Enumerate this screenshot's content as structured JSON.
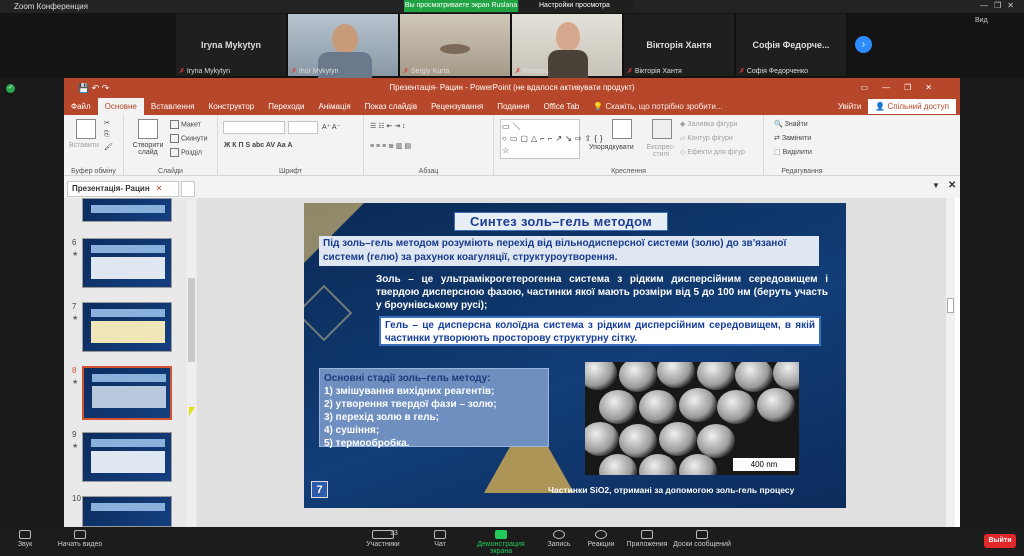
{
  "zoom": {
    "window_title": "Zoom Конференция",
    "share_banner": "Вы просматриваете экран Ruslana",
    "view_options": "Настройки просмотра",
    "view_label": "Вид",
    "exit": "Выйти"
  },
  "participants": [
    {
      "name": "Iryna Mykytyn",
      "caption": "Iryna Mykytyn",
      "video": false
    },
    {
      "name": "",
      "caption": "Ihor Mykytyn",
      "video": true
    },
    {
      "name": "",
      "caption": "Sergiy Kurta",
      "video": true
    },
    {
      "name": "",
      "caption": "Ruslana",
      "video": true
    },
    {
      "name": "Вікторія Хантя",
      "caption": "Вікторія Хантя",
      "video": false
    },
    {
      "name": "Софія Федорче...",
      "caption": "Софія Федорченко",
      "video": false
    }
  ],
  "toolbar": {
    "audio": "Звук",
    "video": "Начать видео",
    "participants": "Участники",
    "participants_count": "13",
    "chat": "Чат",
    "share": "Демонстрация экрана",
    "record": "Запись",
    "reactions": "Реакции",
    "apps": "Приложения",
    "whiteboards": "Доски сообщений"
  },
  "ppt": {
    "title": "Презентація- Рацин - PowerPoint (не вдалося активувати продукт)",
    "tabs": [
      "Файл",
      "Основне",
      "Вставлення",
      "Конструктор",
      "Переходи",
      "Анімація",
      "Показ слайдів",
      "Рецензування",
      "Подання",
      "Office Tab"
    ],
    "active_tab": "Основне",
    "tell_me": "Скажіть, що потрібно зробити...",
    "sign_in": "Увійти",
    "share": "Спільний доступ",
    "ribbon": {
      "paste": "Вставити",
      "clipboard": "Буфер обміну",
      "new_slide": "Створити слайд",
      "layout": "Макет",
      "reset": "Скинути",
      "section": "Розділ",
      "slides": "Слайди",
      "font": "Шрифт",
      "paragraph": "Абзац",
      "arrange": "Упорядкувати",
      "quick_styles": "Експрес-стилі",
      "shape_fill": "Заливка фігури",
      "shape_outline": "Контур фігури",
      "shape_effects": "Ефекти для фігур",
      "drawing": "Креслення",
      "find": "Знайти",
      "replace": "Замінити",
      "select": "Виділити",
      "editing": "Редагування"
    },
    "file_tab": "Презентація- Рацин",
    "thumb_numbers": [
      "6",
      "7",
      "8",
      "9",
      "10"
    ],
    "selected_slide": "8"
  },
  "slide": {
    "title": "Синтез золь–гель методом",
    "p1": "Під золь–гель методом розуміють перехід від вільнодисперсної системи (золю) до зв'язаної системи (гелю) за рахунок коагуляції, структуроутворення.",
    "p2": "Золь – це ультрамікрогетерогенна система з рідким дисперсійним середовищем і твердою дисперсною фазою, частинки якої мають розміри від 5 до 100 нм (беруть участь у броунівському русі);",
    "p3": "Гель – це дисперсна колоїдна система з рідким дисперсійним середовищем, в якій частинки утворюють просторову структурну сітку.",
    "stages_title": "Основні стадії золь–гель методу:",
    "stages": [
      "1) змішування вихідних реагентів;",
      "2) утворення твердої фази – золю;",
      "3) перехід золю в гель;",
      "4) сушіння;",
      "5) термообробка."
    ],
    "scale": "400 nm",
    "number": "7",
    "caption": "Частинки SiO2, отримані за допомогою золь-гель процесу"
  }
}
